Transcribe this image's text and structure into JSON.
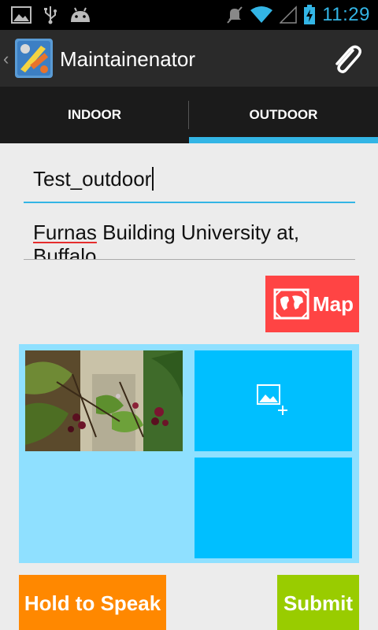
{
  "status_bar": {
    "time": "11:29",
    "left_icons": [
      "image-notification-icon",
      "usb-icon",
      "android-debug-icon"
    ],
    "right_icons": [
      "mute-icon",
      "wifi-icon",
      "signal-icon",
      "battery-charging-icon"
    ]
  },
  "action_bar": {
    "title": "Maintainenator",
    "app_icon": "maintainenator-app-icon",
    "attach_icon": "paperclip-icon"
  },
  "tabs": [
    {
      "label": "INDOOR",
      "selected": false
    },
    {
      "label": "OUTDOOR",
      "selected": true
    }
  ],
  "form": {
    "name_value": "Test_outdoor",
    "address_misspelled": "Furnas",
    "address_rest": " Building University at, Buffalo"
  },
  "map_button": {
    "label": "Map",
    "icon": "map-icon"
  },
  "photos": {
    "add_icon": "add-image-icon"
  },
  "buttons": {
    "speak": "Hold to Speak",
    "submit": "Submit"
  },
  "colors": {
    "accent": "#33b5e5",
    "map": "#ff4444",
    "photo_panel": "#8fe0ff",
    "tile": "#00bfff",
    "speak": "#ff8800",
    "submit": "#99cc00"
  }
}
